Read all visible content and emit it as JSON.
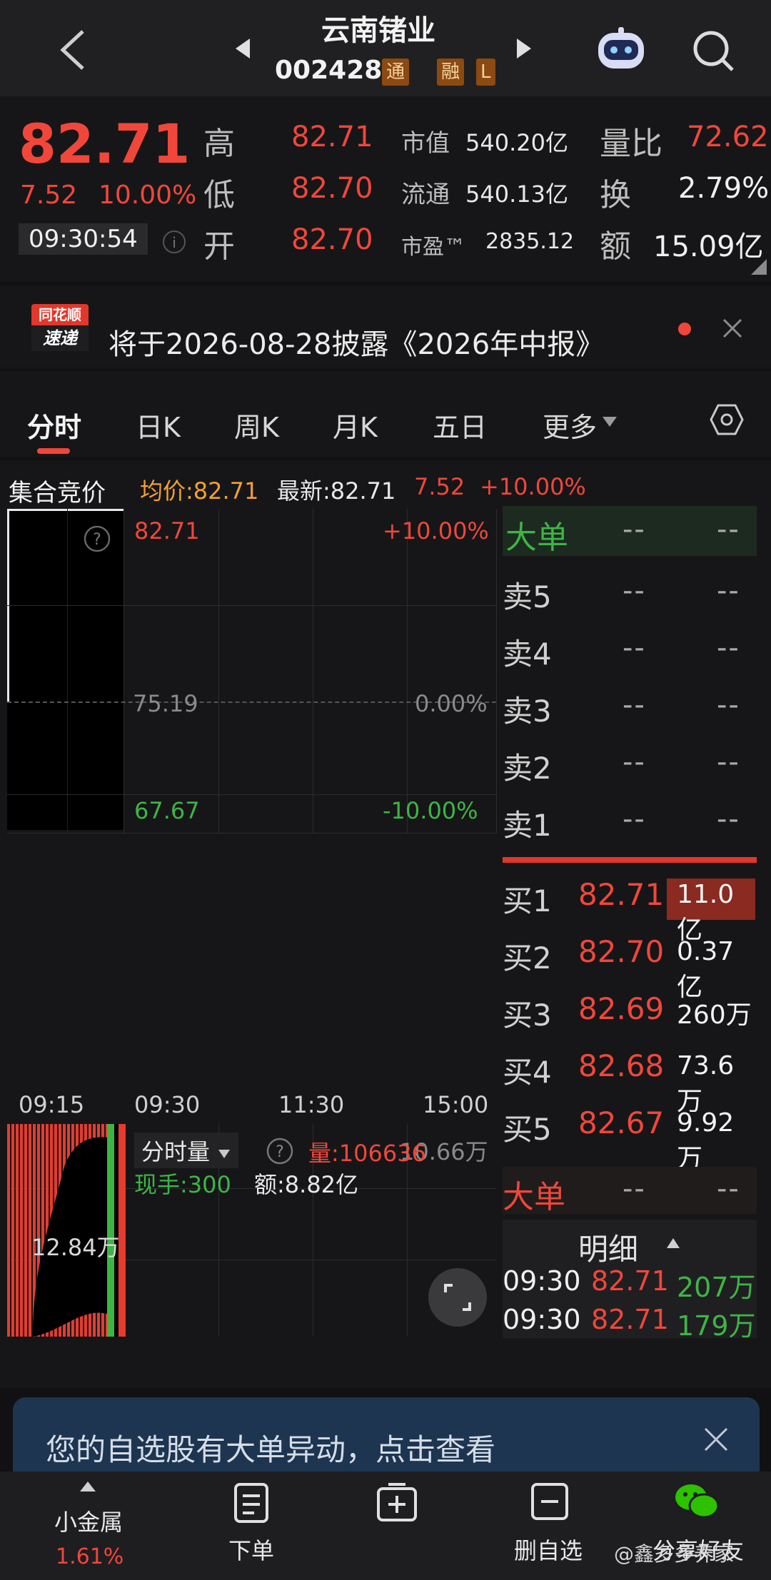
{
  "header": {
    "stock_name": "云南锗业",
    "stock_code": "002428",
    "badge_tong": "通",
    "badge_rong": "融",
    "badge_l": "L"
  },
  "quote": {
    "price": "82.71",
    "change": "7.52",
    "change_pct": "10.00%",
    "time": "09:30:54",
    "high_label": "高",
    "high": "82.71",
    "low_label": "低",
    "low": "82.70",
    "open_label": "开",
    "open": "82.70",
    "mktcap_label": "市值",
    "mktcap": "540.20亿",
    "float_label": "流通",
    "float": "540.13亿",
    "pe_label": "市盈™",
    "pe": "2835.12",
    "vol_ratio_label": "量比",
    "vol_ratio": "72.62",
    "turnover_label": "换",
    "turnover": "2.79%",
    "amount_label": "额",
    "amount": "15.09亿"
  },
  "notice": {
    "logo_top": "同花顺",
    "logo_bottom": "速递",
    "text": "将于2026-08-28披露《2026年中报》"
  },
  "tabs": [
    "分时",
    "日K",
    "周K",
    "月K",
    "五日",
    "更多"
  ],
  "info_row": {
    "auction": "集合竞价",
    "avg": "均价:82.71",
    "latest": "最新:82.71",
    "change": "7.52",
    "change_pct": "+10.00%"
  },
  "chart": {
    "upper_price": "82.71",
    "upper_pct": "+10.00%",
    "mid_price": "75.19",
    "mid_pct": "0.00%",
    "lower_price": "67.67",
    "lower_pct": "-10.00%",
    "times": [
      "09:15",
      "09:30",
      "11:30",
      "15:00"
    ],
    "vol_selector": "分时量",
    "vol_value": "量:106636",
    "vol_axis": "10.66万",
    "vol_mid": "12.84万",
    "current_hand": "现手:300",
    "amount": "额:8.82亿"
  },
  "order_book": {
    "big_label": "大单",
    "big_a": "--",
    "big_b": "--",
    "sells": [
      {
        "label": "卖5",
        "price": "--",
        "vol": "--"
      },
      {
        "label": "卖4",
        "price": "--",
        "vol": "--"
      },
      {
        "label": "卖3",
        "price": "--",
        "vol": "--"
      },
      {
        "label": "卖2",
        "price": "--",
        "vol": "--"
      },
      {
        "label": "卖1",
        "price": "--",
        "vol": "--"
      }
    ],
    "buys": [
      {
        "label": "买1",
        "price": "82.71",
        "vol": "11.0亿"
      },
      {
        "label": "买2",
        "price": "82.70",
        "vol": "0.37亿"
      },
      {
        "label": "买3",
        "price": "82.69",
        "vol": "260万"
      },
      {
        "label": "买4",
        "price": "82.68",
        "vol": "73.6万"
      },
      {
        "label": "买5",
        "price": "82.67",
        "vol": "9.92万"
      }
    ],
    "big2_label": "大单",
    "big2_a": "--",
    "big2_b": "--",
    "detail_label": "明细",
    "details": [
      {
        "time": "09:30",
        "price": "82.71",
        "vol": "207万"
      },
      {
        "time": "09:30",
        "price": "82.71",
        "vol": "179万"
      }
    ]
  },
  "toast": {
    "text": "您的自选股有大单异动，点击查看"
  },
  "bottom_nav": {
    "sector": "小金属",
    "sector_pct": "1.61%",
    "order": "下单",
    "remove": "删自选",
    "share": "分享好友",
    "watermark": "@鑫多多养家"
  },
  "colors": {
    "up": "#f0473a",
    "down": "#3db545",
    "bg": "#161618"
  }
}
